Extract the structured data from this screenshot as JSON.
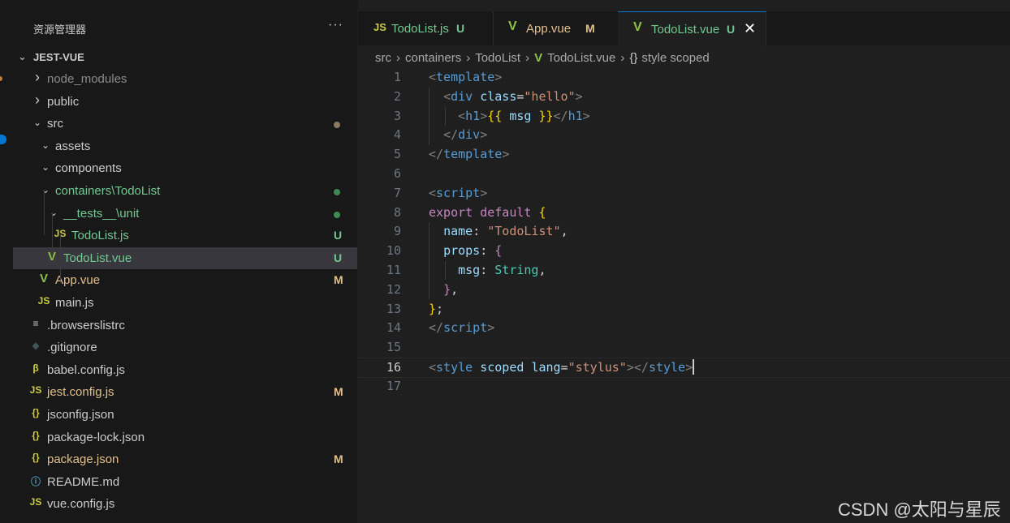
{
  "explorer": {
    "title": "资源管理器",
    "more": "···",
    "project": "JEST-VUE",
    "items": [
      {
        "name": "node_modules",
        "type": "folder",
        "open": false,
        "depth": 1,
        "color": "#8b8b8b",
        "badge": "",
        "dot": ""
      },
      {
        "name": "public",
        "type": "folder",
        "open": false,
        "depth": 1,
        "color": "#cccccc",
        "badge": "",
        "dot": ""
      },
      {
        "name": "src",
        "type": "folder",
        "open": true,
        "depth": 1,
        "color": "#cccccc",
        "badge": "",
        "dot": "#8a7a60"
      },
      {
        "name": "assets",
        "type": "folder",
        "open": true,
        "depth": 2,
        "color": "#cccccc",
        "badge": "",
        "dot": ""
      },
      {
        "name": "components",
        "type": "folder",
        "open": true,
        "depth": 2,
        "color": "#cccccc",
        "badge": "",
        "dot": ""
      },
      {
        "name": "containers\\TodoList",
        "type": "folder",
        "open": true,
        "depth": 2,
        "color": "#73c991",
        "badge": "",
        "dot": "#3f8a52"
      },
      {
        "name": "__tests__\\unit",
        "type": "folder",
        "open": true,
        "depth": 3,
        "color": "#73c991",
        "badge": "",
        "dot": "#3f8a52"
      },
      {
        "name": "TodoList.js",
        "type": "js",
        "depth": 4,
        "color": "#73c991",
        "badge": "U",
        "badgeColor": "#73c991",
        "dot": ""
      },
      {
        "name": "TodoList.vue",
        "type": "vue",
        "depth": 3,
        "color": "#73c991",
        "badge": "U",
        "badgeColor": "#73c991",
        "dot": "",
        "selected": true
      },
      {
        "name": "App.vue",
        "type": "vue",
        "depth": 2,
        "color": "#e2c08d",
        "badge": "M",
        "badgeColor": "#e2c08d",
        "dot": ""
      },
      {
        "name": "main.js",
        "type": "js",
        "depth": 2,
        "color": "#cccccc",
        "badge": "",
        "dot": ""
      },
      {
        "name": ".browserslistrc",
        "type": "lines",
        "depth": 1,
        "color": "#cccccc",
        "badge": "",
        "dot": ""
      },
      {
        "name": ".gitignore",
        "type": "git",
        "depth": 1,
        "color": "#cccccc",
        "badge": "",
        "dot": ""
      },
      {
        "name": "babel.config.js",
        "type": "babel",
        "depth": 1,
        "color": "#cccccc",
        "badge": "",
        "dot": ""
      },
      {
        "name": "jest.config.js",
        "type": "js",
        "depth": 1,
        "color": "#e2c08d",
        "badge": "M",
        "badgeColor": "#e2c08d",
        "dot": ""
      },
      {
        "name": "jsconfig.json",
        "type": "json",
        "depth": 1,
        "color": "#cccccc",
        "badge": "",
        "dot": ""
      },
      {
        "name": "package-lock.json",
        "type": "json",
        "depth": 1,
        "color": "#cccccc",
        "badge": "",
        "dot": ""
      },
      {
        "name": "package.json",
        "type": "json",
        "depth": 1,
        "color": "#e2c08d",
        "badge": "M",
        "badgeColor": "#e2c08d",
        "dot": ""
      },
      {
        "name": "README.md",
        "type": "info",
        "depth": 1,
        "color": "#cccccc",
        "badge": "",
        "dot": ""
      },
      {
        "name": "vue.config.js",
        "type": "js",
        "depth": 1,
        "color": "#cccccc",
        "badge": "",
        "dot": ""
      }
    ]
  },
  "icons": {
    "js": "JS",
    "vue": "V",
    "json": "{}",
    "lines": "≡",
    "git": "◆",
    "babel": "β",
    "info": "ⓘ",
    "chevron_right": "›",
    "chevron_down": "⌄",
    "close": "✕"
  },
  "tabs": [
    {
      "label": "TodoList.js",
      "icon": "js",
      "status": "U",
      "labelColor": "#73c991",
      "statusColor": "#73c991",
      "active": false
    },
    {
      "label": "App.vue",
      "icon": "vue",
      "status": "M",
      "labelColor": "#e2c08d",
      "statusColor": "#e2c08d",
      "active": false
    },
    {
      "label": "TodoList.vue",
      "icon": "vue",
      "status": "U",
      "labelColor": "#73c991",
      "statusColor": "#73c991",
      "active": true
    }
  ],
  "breadcrumbs": [
    "src",
    "containers",
    "TodoList",
    "TodoList.vue",
    "style scoped"
  ],
  "breadcrumb_sep": "›",
  "code": {
    "current_line": 16,
    "lines": [
      [
        [
          "t-br",
          "<"
        ],
        [
          "t-tag",
          "template"
        ],
        [
          "t-br",
          ">"
        ]
      ],
      [
        [
          "t-plain",
          "  "
        ],
        [
          "t-br",
          "<"
        ],
        [
          "t-tag",
          "div"
        ],
        [
          "t-plain",
          " "
        ],
        [
          "t-attr",
          "class"
        ],
        [
          "t-plain",
          "="
        ],
        [
          "t-str",
          "\"hello\""
        ],
        [
          "t-br",
          ">"
        ]
      ],
      [
        [
          "t-plain",
          "    "
        ],
        [
          "t-br",
          "<"
        ],
        [
          "t-tag",
          "h1"
        ],
        [
          "t-br",
          ">"
        ],
        [
          "t-fn",
          "{{"
        ],
        [
          "t-plain",
          " "
        ],
        [
          "t-attr",
          "msg"
        ],
        [
          "t-plain",
          " "
        ],
        [
          "t-fn",
          "}}"
        ],
        [
          "t-br",
          "</"
        ],
        [
          "t-tag",
          "h1"
        ],
        [
          "t-br",
          ">"
        ]
      ],
      [
        [
          "t-plain",
          "  "
        ],
        [
          "t-br",
          "</"
        ],
        [
          "t-tag",
          "div"
        ],
        [
          "t-br",
          ">"
        ]
      ],
      [
        [
          "t-br",
          "</"
        ],
        [
          "t-tag",
          "template"
        ],
        [
          "t-br",
          ">"
        ]
      ],
      [],
      [
        [
          "t-br",
          "<"
        ],
        [
          "t-tag",
          "script"
        ],
        [
          "t-br",
          ">"
        ]
      ],
      [
        [
          "t-kw",
          "export"
        ],
        [
          "t-plain",
          " "
        ],
        [
          "t-kw",
          "default"
        ],
        [
          "t-plain",
          " "
        ],
        [
          "t-fn",
          "{"
        ]
      ],
      [
        [
          "t-plain",
          "  "
        ],
        [
          "t-prop",
          "name"
        ],
        [
          "t-plain",
          ": "
        ],
        [
          "t-str",
          "\"TodoList\""
        ],
        [
          "t-plain",
          ","
        ]
      ],
      [
        [
          "t-plain",
          "  "
        ],
        [
          "t-prop",
          "props"
        ],
        [
          "t-plain",
          ": "
        ],
        [
          "t-kw",
          "{"
        ]
      ],
      [
        [
          "t-plain",
          "    "
        ],
        [
          "t-prop",
          "msg"
        ],
        [
          "t-plain",
          ": "
        ],
        [
          "t-type",
          "String"
        ],
        [
          "t-plain",
          ","
        ]
      ],
      [
        [
          "t-plain",
          "  "
        ],
        [
          "t-kw",
          "}"
        ],
        [
          "t-plain",
          ","
        ]
      ],
      [
        [
          "t-fn",
          "}"
        ],
        [
          "t-plain",
          ";"
        ]
      ],
      [
        [
          "t-br",
          "</"
        ],
        [
          "t-tag",
          "script"
        ],
        [
          "t-br",
          ">"
        ]
      ],
      [],
      [
        [
          "t-br",
          "<"
        ],
        [
          "t-tag",
          "style"
        ],
        [
          "t-plain",
          " "
        ],
        [
          "t-attr",
          "scoped"
        ],
        [
          "t-plain",
          " "
        ],
        [
          "t-attr",
          "lang"
        ],
        [
          "t-plain",
          "="
        ],
        [
          "t-str",
          "\"stylus\""
        ],
        [
          "t-br",
          "></"
        ],
        [
          "t-tag",
          "style"
        ],
        [
          "t-br",
          ">"
        ]
      ],
      []
    ]
  },
  "watermark": "CSDN @太阳与星辰",
  "colors": {
    "accent": "#0078d4",
    "untracked": "#73c991",
    "modified": "#e2c08d",
    "js_icon": "#cbcb41",
    "vue_icon": "#8dc149"
  }
}
